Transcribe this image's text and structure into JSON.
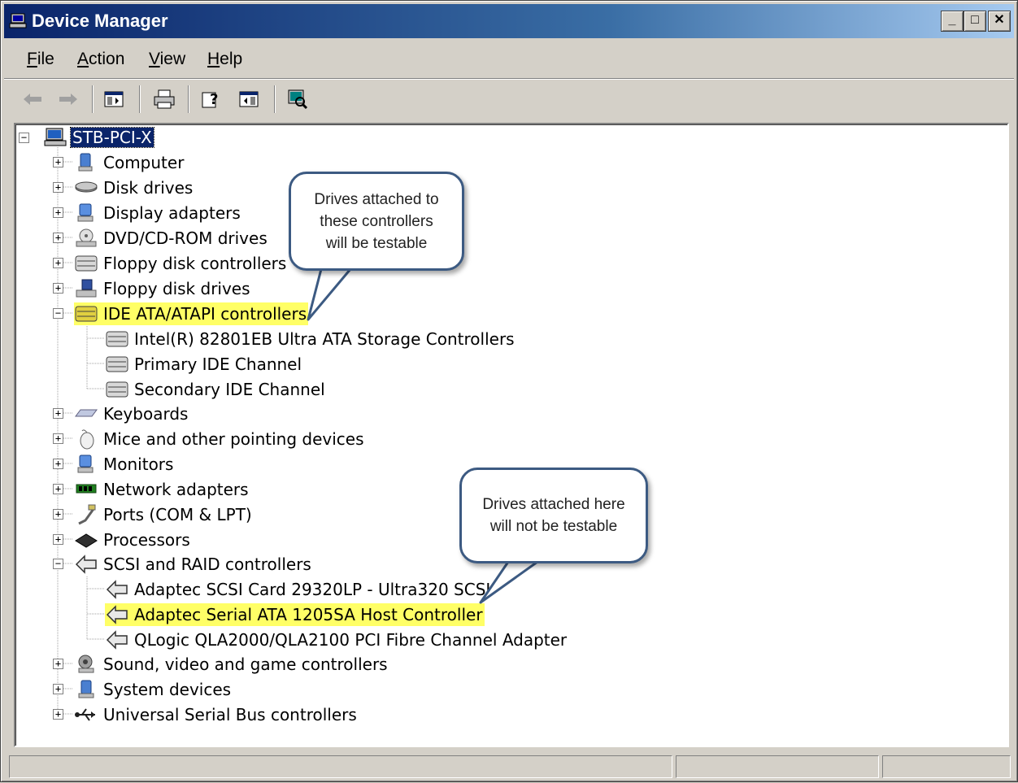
{
  "window": {
    "title": "Device Manager",
    "controls": {
      "minimize": "_",
      "maximize": "□",
      "close": "✕"
    }
  },
  "menu": {
    "items": [
      {
        "label_accel": "F",
        "label_rest": "ile"
      },
      {
        "label_accel": "A",
        "label_rest": "ction"
      },
      {
        "label_accel": "V",
        "label_rest": "iew"
      },
      {
        "label_accel": "H",
        "label_rest": "elp"
      }
    ]
  },
  "toolbar": {
    "icons": [
      "back-arrow-icon",
      "forward-arrow-icon",
      "show-hide-tree-icon",
      "print-icon",
      "help-icon",
      "properties-icon",
      "scan-hardware-icon"
    ]
  },
  "tree": {
    "root": {
      "label": "STB-PCI-X",
      "expander": "−"
    },
    "categories": [
      {
        "label": "Computer",
        "expander": "+"
      },
      {
        "label": "Disk drives",
        "expander": "+"
      },
      {
        "label": "Display adapters",
        "expander": "+"
      },
      {
        "label": "DVD/CD-ROM drives",
        "expander": "+"
      },
      {
        "label": "Floppy disk controllers",
        "expander": "+"
      },
      {
        "label": "Floppy disk drives",
        "expander": "+"
      },
      {
        "label": "IDE ATA/ATAPI controllers",
        "expander": "−"
      },
      {
        "label": "Intel(R) 82801EB Ultra ATA Storage Controllers"
      },
      {
        "label": "Primary IDE Channel"
      },
      {
        "label": "Secondary IDE Channel"
      },
      {
        "label": "Keyboards",
        "expander": "+"
      },
      {
        "label": "Mice and other pointing devices",
        "expander": "+"
      },
      {
        "label": "Monitors",
        "expander": "+"
      },
      {
        "label": "Network adapters",
        "expander": "+"
      },
      {
        "label": "Ports (COM & LPT)",
        "expander": "+"
      },
      {
        "label": "Processors",
        "expander": "+"
      },
      {
        "label": "SCSI and RAID controllers",
        "expander": "−"
      },
      {
        "label": "Adaptec SCSI Card 29320LP - Ultra320 SCSI"
      },
      {
        "label": "Adaptec Serial ATA 1205SA Host Controller"
      },
      {
        "label": "QLogic QLA2000/QLA2100 PCI Fibre Channel Adapter"
      },
      {
        "label": "Sound, video and game controllers",
        "expander": "+"
      },
      {
        "label": "System devices",
        "expander": "+"
      },
      {
        "label": "Universal Serial Bus controllers",
        "expander": "+"
      }
    ]
  },
  "callouts": {
    "top": [
      "Drives attached to",
      "these controllers",
      "will be testable"
    ],
    "bottom": [
      "Drives attached here",
      "will not be testable"
    ]
  },
  "colors": {
    "highlight": "#ffff66",
    "selection": "#0a246a",
    "callout_border": "#3c5a82"
  }
}
